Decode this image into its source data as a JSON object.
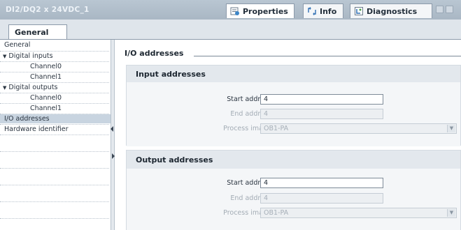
{
  "title": "DI2/DQ2 x 24VDC_1",
  "tabs": [
    {
      "label": "Properties",
      "icon": "properties-icon",
      "active": true
    },
    {
      "label": "Info",
      "icon": "info-icon",
      "active": false
    },
    {
      "label": "Diagnostics",
      "icon": "diagnostics-icon",
      "active": false
    }
  ],
  "subtab": {
    "label": "General"
  },
  "nav": {
    "items": [
      {
        "label": "General"
      },
      {
        "label": "Digital inputs",
        "expanded": true
      },
      {
        "label": "Channel0"
      },
      {
        "label": "Channel1"
      },
      {
        "label": "Digital outputs",
        "expanded": true
      },
      {
        "label": "Channel0"
      },
      {
        "label": "Channel1"
      },
      {
        "label": "I/O addresses",
        "selected": true
      },
      {
        "label": "Hardware identifier"
      }
    ]
  },
  "main": {
    "section_title": "I/O addresses",
    "input_group": {
      "title": "Input addresses",
      "start_label": "Start address:",
      "start_value": "4",
      "end_label": "End address:",
      "end_value": "4",
      "process_label": "Process image:",
      "process_value": "OB1-PA"
    },
    "output_group": {
      "title": "Output addresses",
      "start_label": "Start address:",
      "start_value": "4",
      "end_label": "End address:",
      "end_value": "4",
      "process_label": "Process image:",
      "process_value": "OB1-PA"
    }
  },
  "colors": {
    "selection": "#c8d4e0",
    "titlebar": "#b1bfcc",
    "accent": "#2f6fb3"
  }
}
